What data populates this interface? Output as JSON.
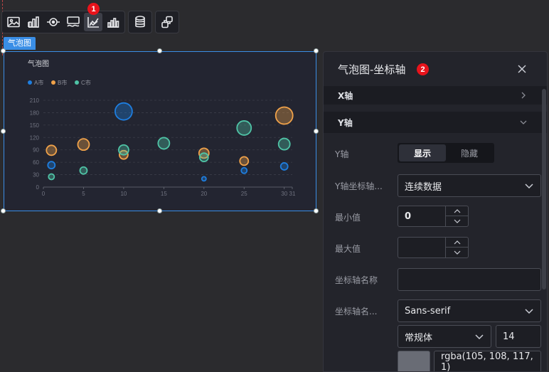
{
  "toolbar": {
    "group1": [
      {
        "name": "image-icon"
      },
      {
        "name": "bar-chart-icon"
      },
      {
        "name": "target-icon"
      },
      {
        "name": "monitor-wave-icon"
      },
      {
        "name": "bubble-axis-icon"
      },
      {
        "name": "histogram-icon"
      }
    ],
    "group2": [
      {
        "name": "database-icon"
      }
    ],
    "group3": [
      {
        "name": "share-link-icon"
      }
    ],
    "badge1": "1"
  },
  "component": {
    "tag": "气泡图"
  },
  "chart_data": {
    "type": "scatter",
    "title": "气泡图",
    "legend": [
      "A市",
      "B市",
      "C市"
    ],
    "legend_placement": "top-left",
    "colors": {
      "A市": "#1e7ee0",
      "B市": "#f0a24a",
      "C市": "#4fc4a6"
    },
    "xlim": [
      0,
      31
    ],
    "ylim": [
      0,
      210
    ],
    "x_ticks": [
      "0",
      "5",
      "10",
      "15",
      "20",
      "25",
      "30",
      "31"
    ],
    "y_ticks": [
      "0",
      "30",
      "60",
      "90",
      "120",
      "150",
      "180",
      "210"
    ],
    "grid": true,
    "series": [
      {
        "name": "A市",
        "color": "#1e7ee0",
        "points": [
          {
            "x": 1,
            "y": 53,
            "size": 5
          },
          {
            "x": 10,
            "y": 183,
            "size": 12
          },
          {
            "x": 20,
            "y": 20,
            "size": 3
          },
          {
            "x": 25,
            "y": 40,
            "size": 4
          },
          {
            "x": 30,
            "y": 50,
            "size": 5
          }
        ]
      },
      {
        "name": "B市",
        "color": "#f0a24a",
        "points": [
          {
            "x": 1,
            "y": 89,
            "size": 7
          },
          {
            "x": 5,
            "y": 103,
            "size": 8
          },
          {
            "x": 10,
            "y": 78,
            "size": 6
          },
          {
            "x": 20,
            "y": 82,
            "size": 7
          },
          {
            "x": 25,
            "y": 63,
            "size": 6
          },
          {
            "x": 30,
            "y": 173,
            "size": 12
          }
        ]
      },
      {
        "name": "C市",
        "color": "#4fc4a6",
        "points": [
          {
            "x": 1,
            "y": 25,
            "size": 4
          },
          {
            "x": 5,
            "y": 40,
            "size": 5
          },
          {
            "x": 10,
            "y": 90,
            "size": 7
          },
          {
            "x": 15,
            "y": 106,
            "size": 8
          },
          {
            "x": 20,
            "y": 72,
            "size": 6
          },
          {
            "x": 25,
            "y": 143,
            "size": 10
          },
          {
            "x": 30,
            "y": 104,
            "size": 8
          }
        ]
      }
    ]
  },
  "panel": {
    "title": "气泡图-坐标轴",
    "badge2": "2",
    "x_section": "X轴",
    "y_section": "Y轴",
    "rows": {
      "y_axis_label": "Y轴",
      "show_label": "显示",
      "hide_label": "隐藏",
      "axis_type_label": "Y轴坐标轴...",
      "axis_type_value": "连续数据",
      "min_label": "最小值",
      "min_value": "0",
      "max_label": "最大值",
      "max_value": "",
      "axis_name_label": "坐标轴名称",
      "axis_name_value": "",
      "axis_font_label": "坐标轴名...",
      "font_family_value": "Sans-serif",
      "font_style_value": "常规体",
      "font_size_value": "14",
      "color_value": "rgba(105, 108, 117, 1)",
      "color_swatch": "#696c75"
    }
  }
}
